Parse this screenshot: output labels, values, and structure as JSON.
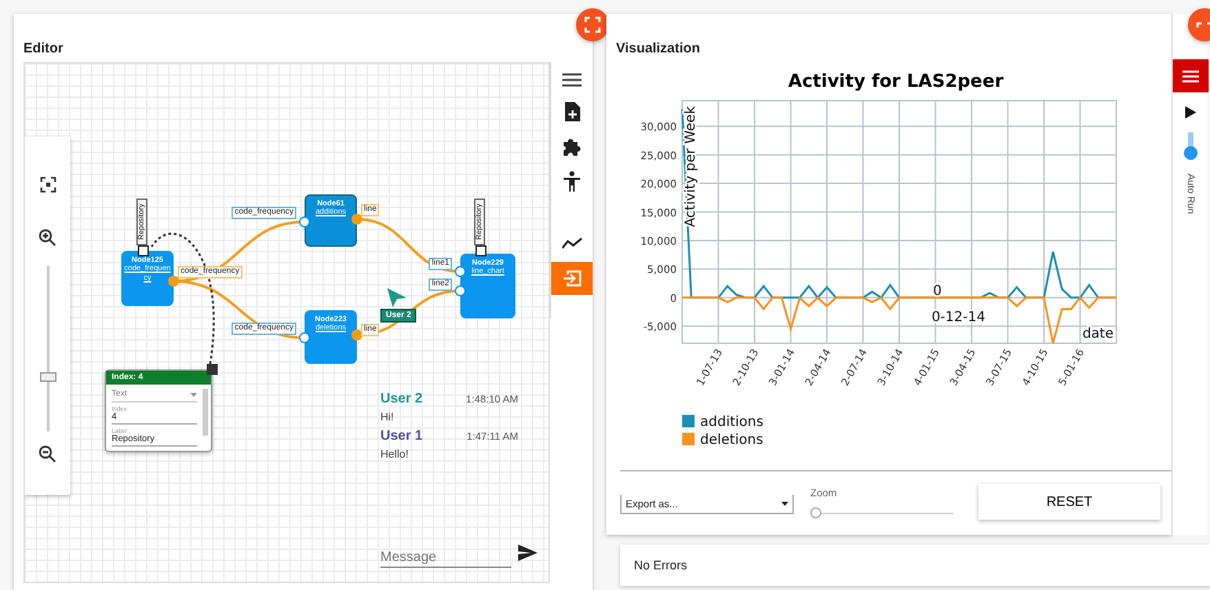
{
  "editor": {
    "title": "Editor",
    "zoom": {
      "level": 0.3
    },
    "nodes": [
      {
        "title": "Node125",
        "label": "code_frequency",
        "selected": false
      },
      {
        "title": "Node61",
        "label": "additions",
        "selected": true
      },
      {
        "title": "Node223",
        "label": "deletions",
        "selected": false
      },
      {
        "title": "Node229",
        "label": "line_chart",
        "selected": false
      }
    ],
    "ports": [
      {
        "label": "code_frequency",
        "kind": "out"
      },
      {
        "label": "code_frequency",
        "kind": "in"
      },
      {
        "label": "line",
        "kind": "out"
      },
      {
        "label": "code_frequency",
        "kind": "in"
      },
      {
        "label": "line",
        "kind": "out"
      },
      {
        "label": "line1",
        "kind": "in"
      },
      {
        "label": "line2",
        "kind": "in"
      }
    ],
    "attributes": [
      "Repository",
      "Repository"
    ],
    "cursor": {
      "user": "User 2"
    },
    "properties": {
      "title": "Index: 4",
      "type": "Text",
      "fields": [
        {
          "label": "Index",
          "value": "4"
        },
        {
          "label": "Label",
          "value": "Repository"
        }
      ]
    },
    "chat": {
      "messages": [
        {
          "user": "User 2",
          "time": "1:48:10 AM",
          "text": "Hi!",
          "color": "#1b9a8c"
        },
        {
          "user": "User 1",
          "time": "1:47:11 AM",
          "text": "Hello!",
          "color": "#4b4fa3"
        }
      ],
      "placeholder": "Message"
    }
  },
  "visualization": {
    "title": "Visualization",
    "chart_data": {
      "type": "line",
      "title": "Activity for LAS2peer",
      "xlabel": "date",
      "ylabel": "Activity per Week",
      "categories": [
        null,
        null,
        null,
        null,
        "1-07-13",
        null,
        null,
        null,
        "2-10-13",
        null,
        null,
        null,
        "3-01-14",
        null,
        null,
        null,
        "2-04-14",
        null,
        null,
        null,
        "2-07-14",
        null,
        null,
        null,
        "3-10-14",
        null,
        null,
        null,
        "4-01-15",
        null,
        null,
        null,
        "3-04-15",
        null,
        null,
        null,
        "3-07-15",
        null,
        null,
        null,
        "4-10-15",
        null,
        null,
        null,
        "5-01-16",
        null,
        null,
        null,
        null
      ],
      "series": [
        {
          "name": "additions",
          "color": "#1a8fb5",
          "values": [
            33000,
            0,
            0,
            0,
            0,
            2000,
            500,
            0,
            0,
            2000,
            0,
            0,
            0,
            0,
            2000,
            0,
            1800,
            0,
            0,
            0,
            0,
            1000,
            0,
            2200,
            0,
            0,
            0,
            0,
            0,
            0,
            0,
            0,
            0,
            0,
            800,
            0,
            0,
            1800,
            0,
            0,
            0,
            8000,
            1500,
            0,
            0,
            2200,
            0,
            0,
            0
          ]
        },
        {
          "name": "deletions",
          "color": "#f7931e",
          "values": [
            0,
            0,
            0,
            0,
            0,
            -800,
            0,
            0,
            0,
            -2000,
            0,
            0,
            -5500,
            0,
            -1500,
            0,
            -1500,
            0,
            0,
            0,
            0,
            -800,
            0,
            -2000,
            0,
            0,
            0,
            0,
            0,
            0,
            0,
            0,
            0,
            0,
            0,
            0,
            0,
            -1500,
            0,
            0,
            0,
            -8000,
            -2000,
            -2000,
            0,
            -1800,
            0,
            0,
            0
          ]
        }
      ],
      "ylim": [
        -8000,
        34500
      ],
      "grid": true,
      "legend": true,
      "yticks": [
        {
          "value": -5000,
          "label": "-5,000"
        },
        {
          "value": 0,
          "label": "0"
        },
        {
          "value": 5000,
          "label": "5,000"
        },
        {
          "value": 10000,
          "label": "10,000"
        },
        {
          "value": 15000,
          "label": "15,000"
        },
        {
          "value": 20000,
          "label": "20,000"
        },
        {
          "value": 25000,
          "label": "25,000"
        },
        {
          "value": 30000,
          "label": "30,000"
        }
      ],
      "annotations": [
        "0",
        "0-12-14"
      ]
    },
    "auto_run": {
      "label": "Auto Run",
      "on": true
    },
    "export": {
      "value": "Export as..."
    },
    "zoom": {
      "label": "Zoom",
      "level": 0
    },
    "reset": "RESET",
    "status": "No Errors"
  }
}
